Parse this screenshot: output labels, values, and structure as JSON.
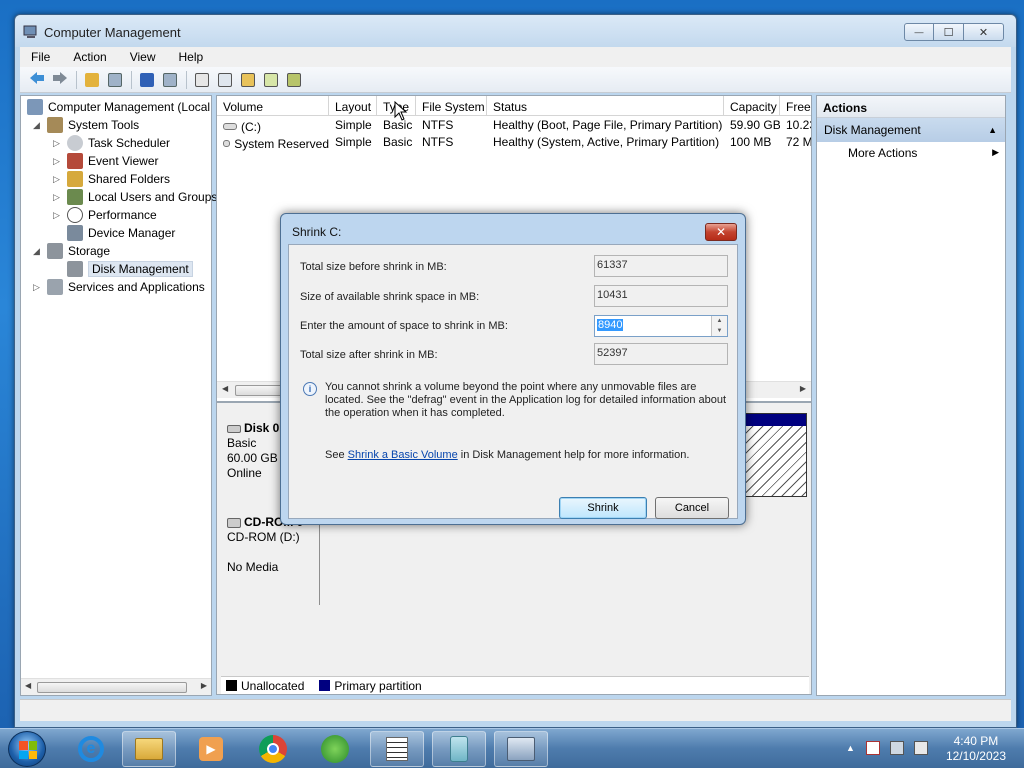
{
  "window": {
    "title": "Computer Management",
    "min": "—",
    "max": "☐",
    "close": "✕"
  },
  "menu": [
    "File",
    "Action",
    "View",
    "Help"
  ],
  "tree": {
    "root": "Computer Management (Local",
    "system_tools": "System Tools",
    "task_scheduler": "Task Scheduler",
    "event_viewer": "Event Viewer",
    "shared_folders": "Shared Folders",
    "local_users": "Local Users and Groups",
    "performance": "Performance",
    "device_manager": "Device Manager",
    "storage": "Storage",
    "disk_management": "Disk Management",
    "services": "Services and Applications"
  },
  "volumes": {
    "headers": [
      "Volume",
      "Layout",
      "Type",
      "File System",
      "Status",
      "Capacity",
      "Free"
    ],
    "rows": [
      [
        "(C:)",
        "Simple",
        "Basic",
        "NTFS",
        "Healthy (Boot, Page File, Primary Partition)",
        "59.90 GB",
        "10.23"
      ],
      [
        "System Reserved",
        "Simple",
        "Basic",
        "NTFS",
        "Healthy (System, Active, Primary Partition)",
        "100 MB",
        "72 M"
      ]
    ]
  },
  "disks": {
    "disk0": {
      "name": "Disk 0",
      "type": "Basic",
      "size": "60.00 GB",
      "state": "Online"
    },
    "cdrom": {
      "name": "CD-ROM 0",
      "drive": "CD-ROM (D:)",
      "media": "No Media"
    }
  },
  "legend": {
    "unallocated": "Unallocated",
    "primary": "Primary partition",
    "unalloc_color": "#000000",
    "primary_color": "#000080"
  },
  "actions": {
    "header": "Actions",
    "section": "Disk Management",
    "more": "More Actions"
  },
  "dialog": {
    "title": "Shrink C:",
    "close": "✕",
    "label_total_before": "Total size before shrink in MB:",
    "value_total_before": "61337",
    "label_available": "Size of available shrink space in MB:",
    "value_available": "10431",
    "label_enter": "Enter the amount of space to shrink in MB:",
    "value_enter": "8940",
    "label_total_after": "Total size after shrink in MB:",
    "value_total_after": "52397",
    "info": "You cannot shrink a volume beyond the point where any unmovable files are located. See the \"defrag\" event in the Application log for detailed information about the operation when it has completed.",
    "see_prefix": "See ",
    "see_link": "Shrink a Basic Volume",
    "see_suffix": " in Disk Management help for more information.",
    "shrink_button": "Shrink",
    "cancel_button": "Cancel"
  },
  "taskbar": {
    "time": "4:40 PM",
    "date": "12/10/2023"
  }
}
